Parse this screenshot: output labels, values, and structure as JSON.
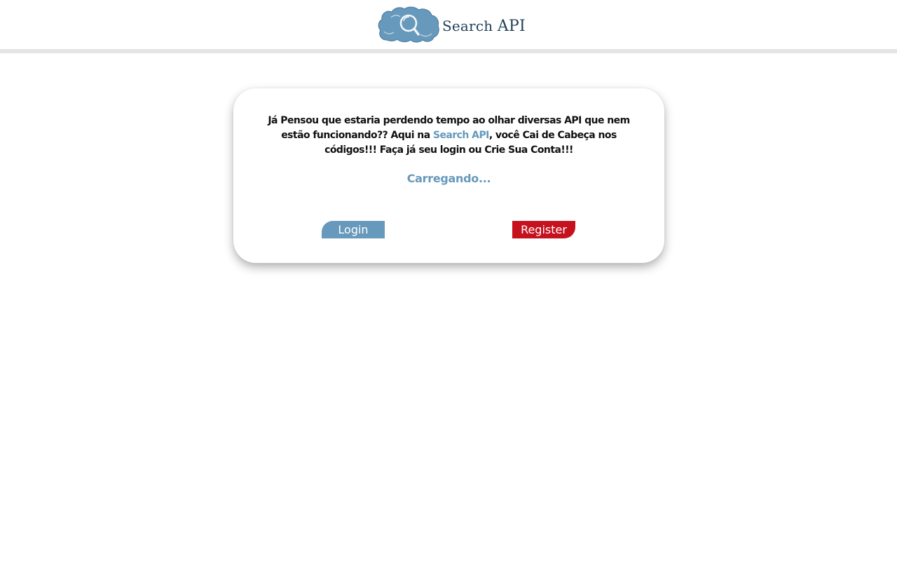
{
  "header": {
    "logo_text_part1": "Search",
    "logo_text_part2": "API",
    "logo_icon": "cloud-magnifier-icon"
  },
  "card": {
    "intro_before": "Já Pensou que estaria perdendo tempo ao olhar diversas API que nem estão funcionando?? Aqui na ",
    "intro_brand": "Search API",
    "intro_after": ", você Cai de Cabeça nos códigos!!! Faça já seu login ou Crie Sua Conta!!!",
    "loading_text": "Carregando...",
    "login_label": "Login",
    "register_label": "Register"
  },
  "colors": {
    "accent_blue": "#6699bb",
    "register_red": "#c5121e",
    "logo_text": "#1f3f57",
    "header_rule": "#e4e4e4"
  }
}
